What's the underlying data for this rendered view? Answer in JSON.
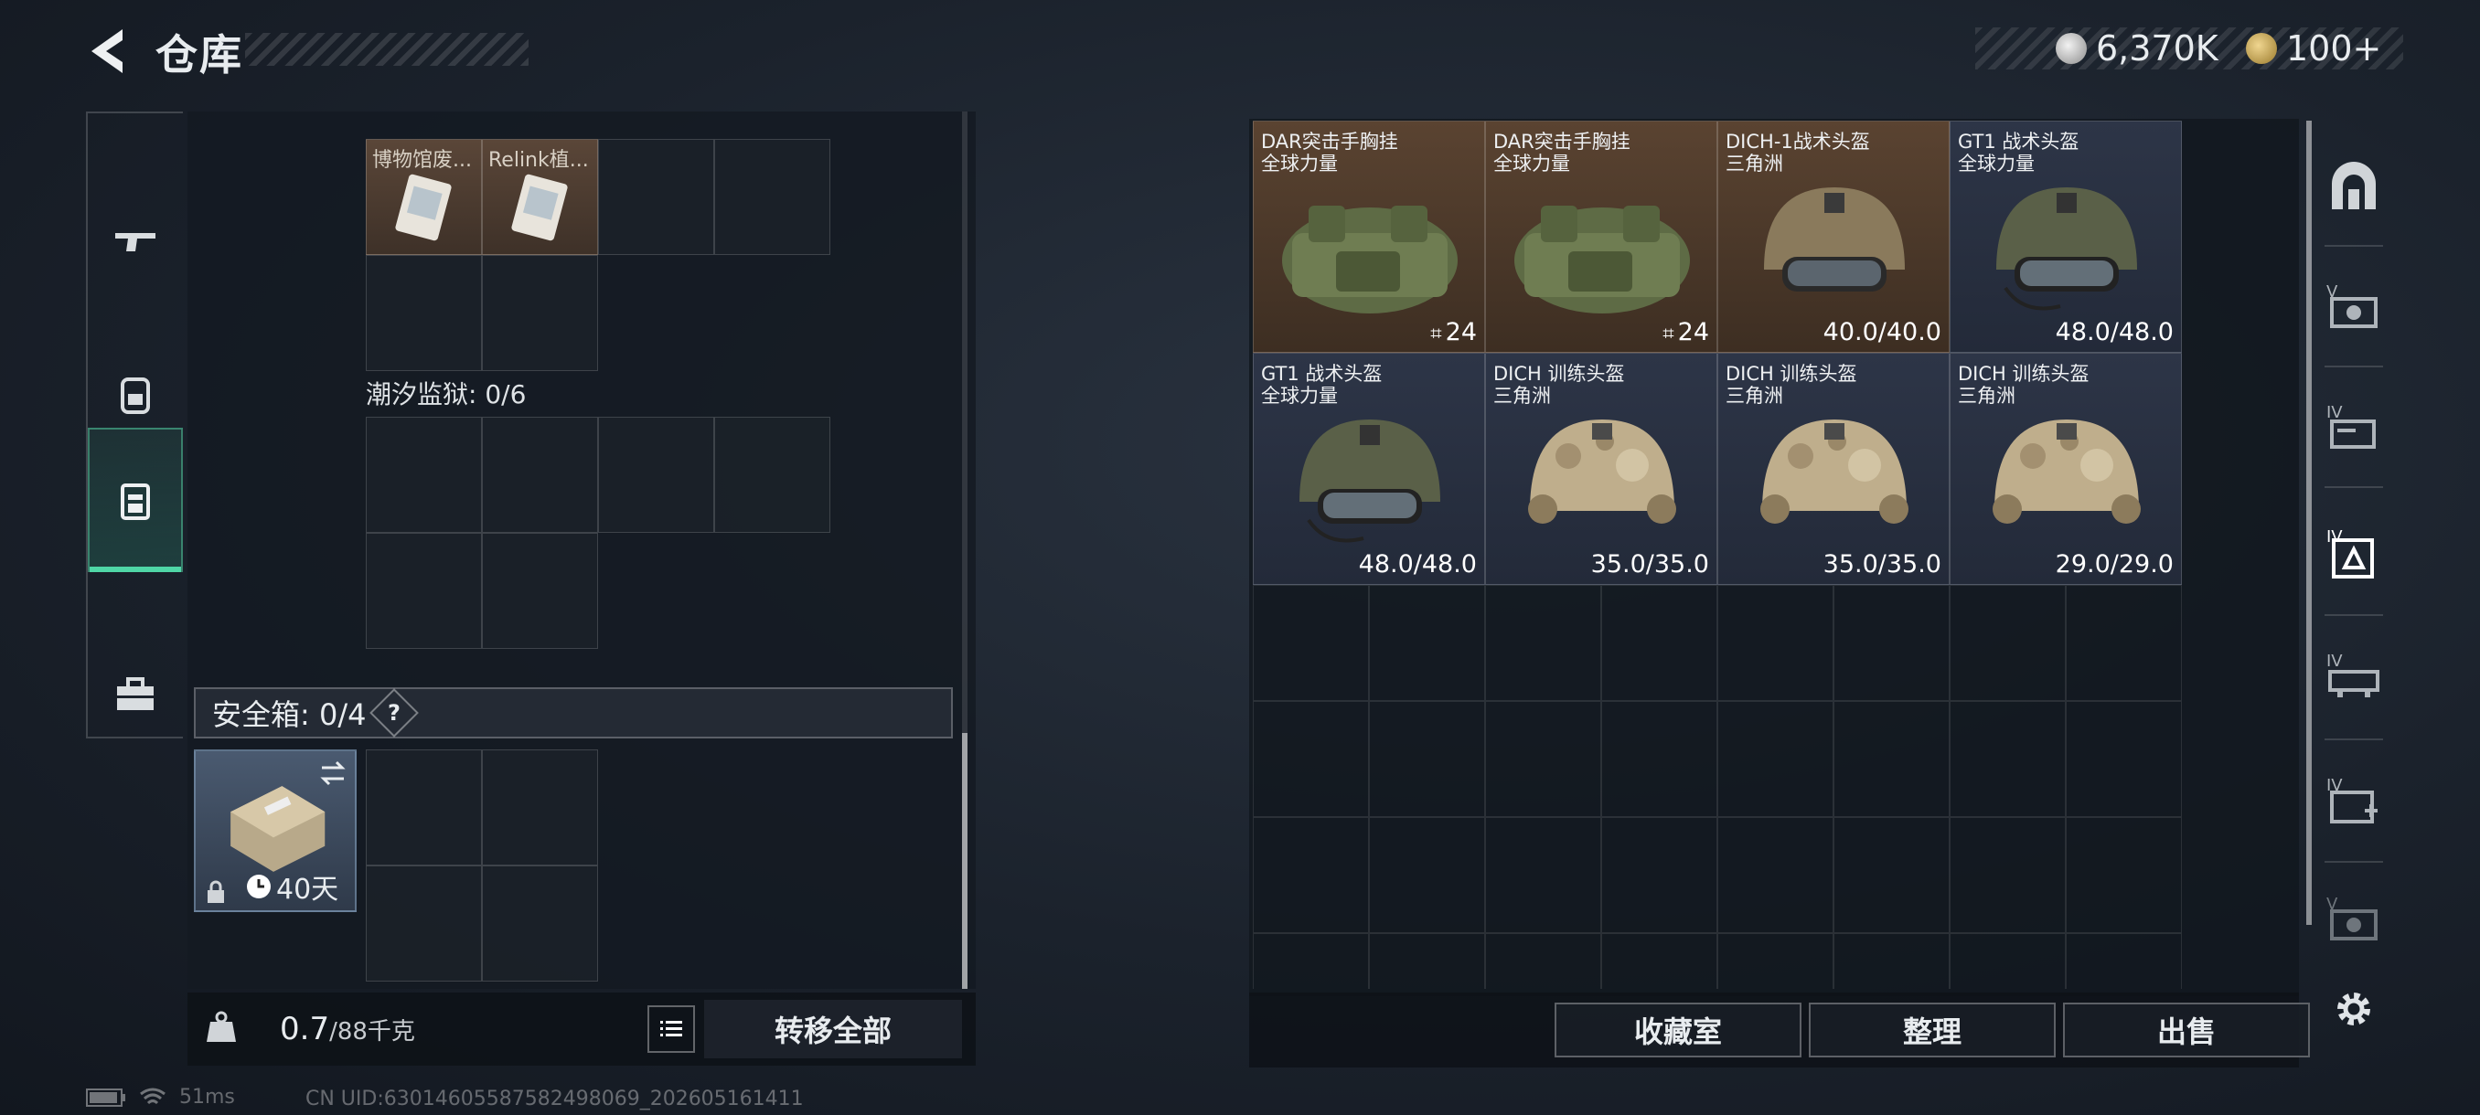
{
  "header": {
    "title": "仓库"
  },
  "currency": {
    "money": "6,370K",
    "tokens": "100+"
  },
  "colors": {
    "accent": "#4fd6a6",
    "item_brown": "#5a4331",
    "item_slate": "#2d3547"
  },
  "left_tabs": [
    {
      "icon": "gun-icon"
    },
    {
      "icon": "backpack-icon"
    },
    {
      "icon": "chest-rig-icon",
      "active": true
    },
    {
      "icon": "toolbox-icon"
    }
  ],
  "container_items": [
    {
      "label": "博物馆废..."
    },
    {
      "label": "Relink植..."
    }
  ],
  "sections": {
    "tide_prison": "潮汐监狱: 0/6",
    "safe_box": "安全箱: 0/4",
    "safe_box_help": "?",
    "safe_box_duration": "40天"
  },
  "weight": {
    "current": "0.7",
    "max": "/88千克"
  },
  "buttons": {
    "transfer_all": "转移全部",
    "collection": "收藏室",
    "sort": "整理",
    "sell": "出售"
  },
  "stash_items": [
    {
      "name": "DAR突击手胸挂",
      "faction": "全球力量",
      "value": "24",
      "kind": "bag",
      "bg": "brown"
    },
    {
      "name": "DAR突击手胸挂",
      "faction": "全球力量",
      "value": "24",
      "kind": "bag",
      "bg": "brown"
    },
    {
      "name": "DICH-1战术头盔",
      "faction": "三角洲",
      "value": "40.0/40.0",
      "kind": "helmet-tan",
      "bg": "brown"
    },
    {
      "name": "GT1 战术头盔",
      "faction": "全球力量",
      "value": "48.0/48.0",
      "kind": "helmet-green",
      "bg": "slate"
    },
    {
      "name": "GT1 战术头盔",
      "faction": "全球力量",
      "value": "48.0/48.0",
      "kind": "helmet-green",
      "bg": "slate"
    },
    {
      "name": "DICH 训练头盔",
      "faction": "三角洲",
      "value": "35.0/35.0",
      "kind": "helmet-camo",
      "bg": "slate"
    },
    {
      "name": "DICH 训练头盔",
      "faction": "三角洲",
      "value": "35.0/35.0",
      "kind": "helmet-camo",
      "bg": "slate"
    },
    {
      "name": "DICH 训练头盔",
      "faction": "三角洲",
      "value": "29.0/29.0",
      "kind": "helmet-camo",
      "bg": "slate"
    }
  ],
  "status": {
    "ping": "51ms",
    "uid": "CN UID:63014605587582498069_202605161411"
  }
}
